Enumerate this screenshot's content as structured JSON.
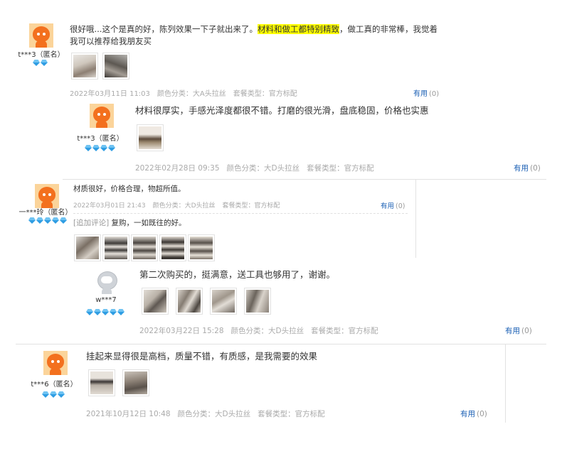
{
  "reviews": [
    {
      "user": "t***3（匿名）",
      "gems": 2,
      "text_before": "很好哦...这个是真的好，陈列效果一下子就出来了。",
      "text_highlight": "材料和做工都特别精致",
      "text_after_line1": "，做工真的非常棒，我觉着",
      "text_line2": "我可以推荐给我朋友买",
      "date": "2022年03月11日 11:03",
      "color_class": "颜色分类：大A头拉丝",
      "package": "套餐类型：官方标配",
      "helpful_label": "有用",
      "helpful_count": "(0)"
    },
    {
      "user": "t***3（匿名）",
      "gems": 4,
      "text": "材料很厚实，手感光泽度都很不错。打磨的很光滑，盘底稳固，价格也实惠",
      "date": "2022年02月28日 09:35",
      "color_class": "颜色分类：大D头拉丝",
      "package": "套餐类型：官方标配",
      "helpful_label": "有用",
      "helpful_count": "(0)"
    },
    {
      "user": "一***玲（匿名）",
      "gems": 5,
      "text": "材质很好，价格合理，物超所值。",
      "date": "2022年03月01日 21:43",
      "color_class": "颜色分类：大D头拉丝",
      "package": "套餐类型：官方标配",
      "helpful_label": "有用",
      "helpful_count": "(0)",
      "append_tag": "[追加评论]",
      "append_text": "复购，一如既往的好。"
    },
    {
      "user": "w***7",
      "gems": 5,
      "text": "第二次购买的，挺满意，送工具也够用了，谢谢。",
      "date": "2022年03月22日 15:28",
      "color_class": "颜色分类：大D头拉丝",
      "package": "套餐类型：官方标配",
      "helpful_label": "有用",
      "helpful_count": "(0)"
    },
    {
      "user": "t***6（匿名）",
      "gems": 3,
      "text": "挂起来显得很是高档，质量不错，有质感，是我需要的效果",
      "date": "2021年10月12日 10:48",
      "color_class": "颜色分类：大D头拉丝",
      "package": "套餐类型：官方标配",
      "helpful_label": "有用",
      "helpful_count": "(0)"
    }
  ],
  "colors": {
    "link": "#1a5fb4",
    "meta": "#aaaaaa",
    "highlight": "#ffff00",
    "avatar_orange": "#f3701e",
    "gem": "#2f9de3"
  }
}
